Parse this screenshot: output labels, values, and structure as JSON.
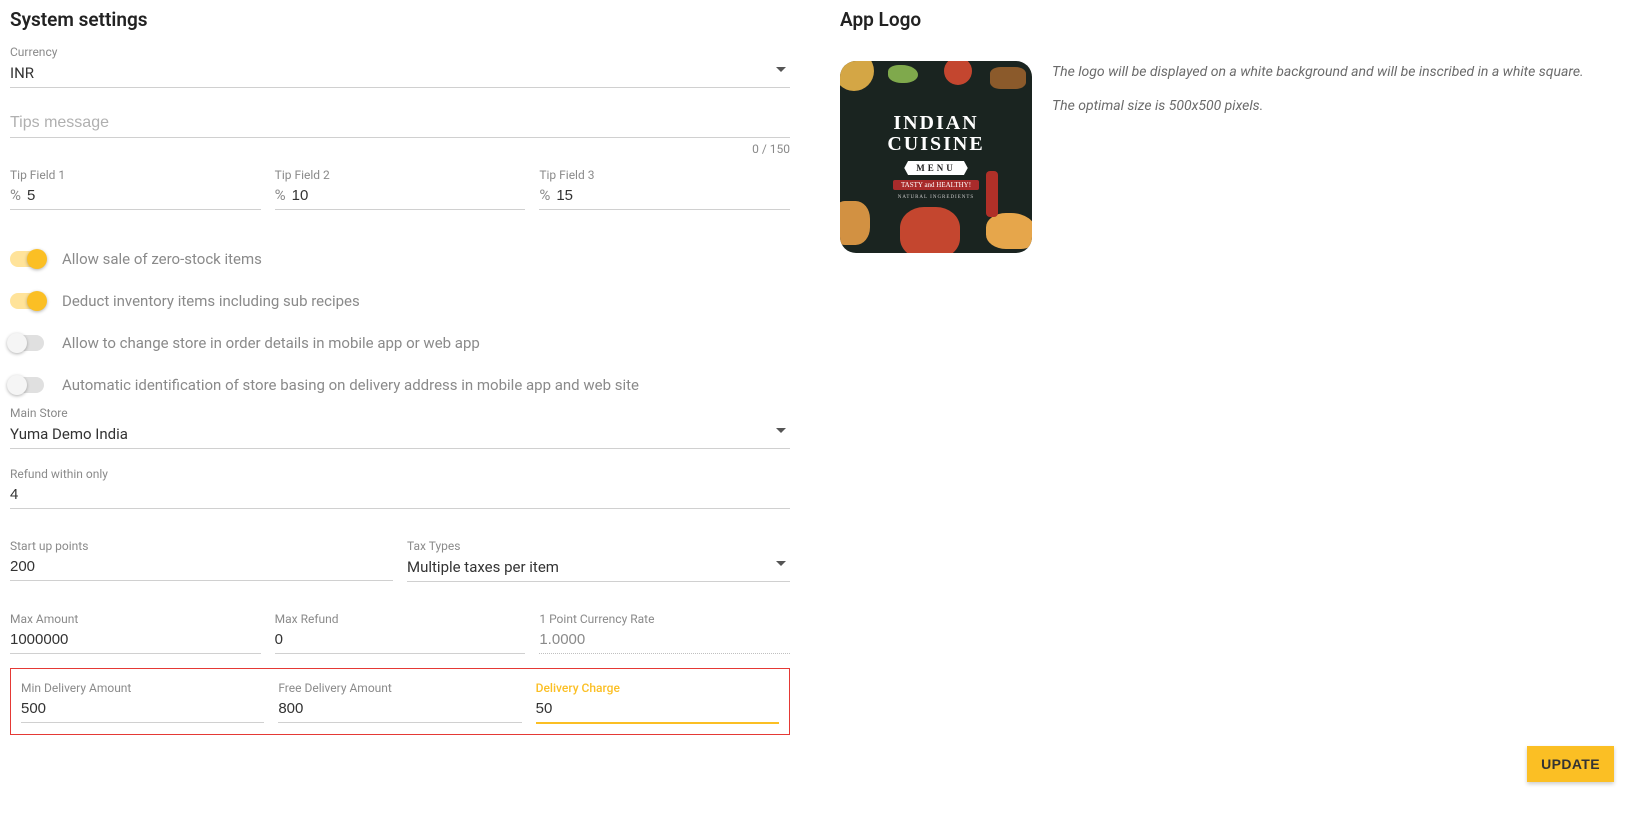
{
  "left": {
    "title": "System settings",
    "currency": {
      "label": "Currency",
      "value": "INR"
    },
    "tips_message": {
      "placeholder": "Tips message",
      "value": "",
      "counter": "0 / 150"
    },
    "tip_fields": [
      {
        "label": "Tip Field 1",
        "prefix": "%",
        "value": "5"
      },
      {
        "label": "Tip Field 2",
        "prefix": "%",
        "value": "10"
      },
      {
        "label": "Tip Field 3",
        "prefix": "%",
        "value": "15"
      }
    ],
    "toggles": [
      {
        "label": "Allow sale of zero-stock items",
        "on": true
      },
      {
        "label": "Deduct inventory items including sub recipes",
        "on": true
      },
      {
        "label": "Allow to change store in order details in mobile app or web app",
        "on": false
      },
      {
        "label": "Automatic identification of store basing on delivery address in mobile app and web site",
        "on": false
      }
    ],
    "main_store": {
      "label": "Main Store",
      "value": "Yuma Demo India"
    },
    "refund_within": {
      "label": "Refund within only",
      "value": "4"
    },
    "startup_points": {
      "label": "Start up points",
      "value": "200"
    },
    "tax_types": {
      "label": "Tax Types",
      "value": "Multiple taxes per item"
    },
    "max_amount": {
      "label": "Max Amount",
      "value": "1000000"
    },
    "max_refund": {
      "label": "Max Refund",
      "value": "0"
    },
    "point_rate": {
      "label": "1 Point Currency Rate",
      "value": "1.0000"
    },
    "min_delivery": {
      "label": "Min Delivery Amount",
      "value": "500"
    },
    "free_delivery": {
      "label": "Free Delivery Amount",
      "value": "800"
    },
    "delivery_charge": {
      "label": "Delivery Charge",
      "value": "50"
    }
  },
  "right": {
    "title": "App Logo",
    "logo": {
      "line1": "INDIAN",
      "line2": "CUISINE",
      "banner": "MENU",
      "sub": "TASTY and HEALTHY!",
      "tiny": "NATURAL INGREDIENTS"
    },
    "desc1": "The logo will be displayed on a white background and will be inscribed in a white square.",
    "desc2": "The optimal size is 500x500 pixels."
  },
  "update_label": "UPDATE"
}
